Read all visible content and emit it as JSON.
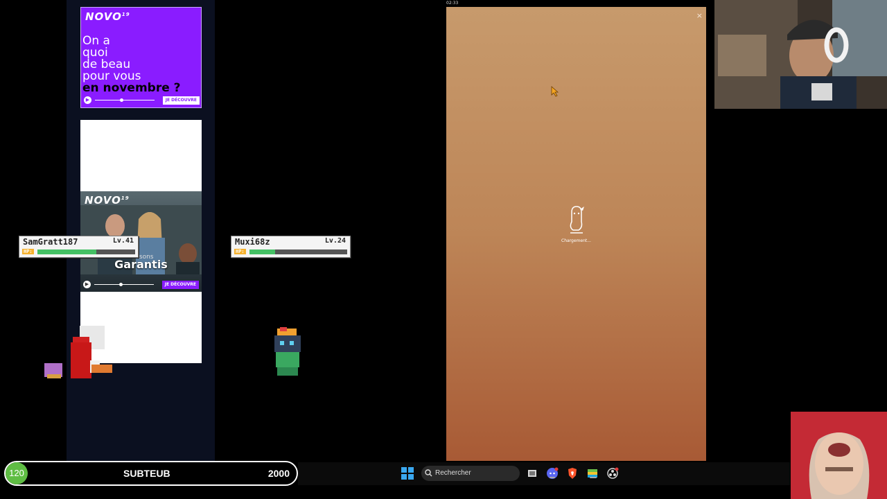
{
  "tray": {
    "time": "02:33"
  },
  "ads": {
    "brand": "NOVO",
    "brand_sup": "19",
    "novembre": {
      "line1": "On a",
      "line2": "quoi",
      "line3": "de beau",
      "line4": "pour vous",
      "highlight": "en novembre ?",
      "cta": "JE DÉCOUVRE"
    },
    "garantis": {
      "subtitle": "Frissons",
      "title": "Garantis",
      "cta": "JE DÉCOUVRE"
    }
  },
  "players": [
    {
      "name": "SamGratt187",
      "level": "Lv.41",
      "hp_label": "HP:",
      "hp_fraction": 0.6
    },
    {
      "name": "Muxi68z",
      "level": "Lv.24",
      "hp_label": "HP:",
      "hp_fraction": 0.26
    }
  ],
  "game": {
    "loading_text": "Chargement...",
    "close_symbol": "×"
  },
  "subgoal": {
    "current": "120",
    "name": "SUBTEUB",
    "target": "2000"
  },
  "taskbar": {
    "search_placeholder": "Rechercher",
    "apps": [
      "windows-start-icon",
      "file-explorer-icon",
      "discord-icon",
      "brave-icon",
      "bluestacks-icon",
      "obs-icon"
    ]
  },
  "colors": {
    "ad_purple": "#8a1cff",
    "hp_green": "#44c064",
    "subgoal_green": "#5fbd44",
    "game_bg_top": "#c79a6c",
    "game_bg_bottom": "#a85a35"
  }
}
